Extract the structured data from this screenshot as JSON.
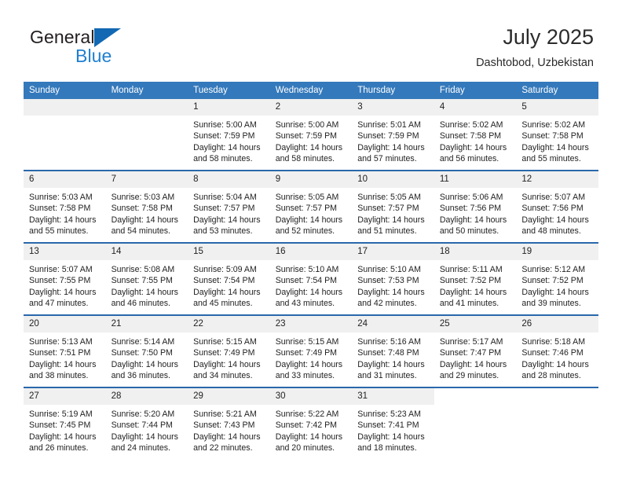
{
  "brand": {
    "name_part1": "General",
    "name_part2": "Blue",
    "logo_icon": "blue-triangle-logo"
  },
  "header": {
    "title": "July 2025",
    "subtitle": "Dashtobod, Uzbekistan"
  },
  "colors": {
    "header_blue": "#3479bb",
    "separator_blue": "#2a68ab",
    "daynum_band": "#f0f0f0",
    "brand_blue": "#1f7fd0",
    "text": "#222222"
  },
  "calendar": {
    "weekday_headers": [
      "Sunday",
      "Monday",
      "Tuesday",
      "Wednesday",
      "Thursday",
      "Friday",
      "Saturday"
    ],
    "weeks": [
      [
        {
          "day": "",
          "empty": true,
          "sunrise": "",
          "sunset": "",
          "daylight1": "",
          "daylight2": ""
        },
        {
          "day": "",
          "empty": true,
          "sunrise": "",
          "sunset": "",
          "daylight1": "",
          "daylight2": ""
        },
        {
          "day": "1",
          "sunrise": "Sunrise: 5:00 AM",
          "sunset": "Sunset: 7:59 PM",
          "daylight1": "Daylight: 14 hours",
          "daylight2": "and 58 minutes."
        },
        {
          "day": "2",
          "sunrise": "Sunrise: 5:00 AM",
          "sunset": "Sunset: 7:59 PM",
          "daylight1": "Daylight: 14 hours",
          "daylight2": "and 58 minutes."
        },
        {
          "day": "3",
          "sunrise": "Sunrise: 5:01 AM",
          "sunset": "Sunset: 7:59 PM",
          "daylight1": "Daylight: 14 hours",
          "daylight2": "and 57 minutes."
        },
        {
          "day": "4",
          "sunrise": "Sunrise: 5:02 AM",
          "sunset": "Sunset: 7:58 PM",
          "daylight1": "Daylight: 14 hours",
          "daylight2": "and 56 minutes."
        },
        {
          "day": "5",
          "sunrise": "Sunrise: 5:02 AM",
          "sunset": "Sunset: 7:58 PM",
          "daylight1": "Daylight: 14 hours",
          "daylight2": "and 55 minutes."
        }
      ],
      [
        {
          "day": "6",
          "sunrise": "Sunrise: 5:03 AM",
          "sunset": "Sunset: 7:58 PM",
          "daylight1": "Daylight: 14 hours",
          "daylight2": "and 55 minutes."
        },
        {
          "day": "7",
          "sunrise": "Sunrise: 5:03 AM",
          "sunset": "Sunset: 7:58 PM",
          "daylight1": "Daylight: 14 hours",
          "daylight2": "and 54 minutes."
        },
        {
          "day": "8",
          "sunrise": "Sunrise: 5:04 AM",
          "sunset": "Sunset: 7:57 PM",
          "daylight1": "Daylight: 14 hours",
          "daylight2": "and 53 minutes."
        },
        {
          "day": "9",
          "sunrise": "Sunrise: 5:05 AM",
          "sunset": "Sunset: 7:57 PM",
          "daylight1": "Daylight: 14 hours",
          "daylight2": "and 52 minutes."
        },
        {
          "day": "10",
          "sunrise": "Sunrise: 5:05 AM",
          "sunset": "Sunset: 7:57 PM",
          "daylight1": "Daylight: 14 hours",
          "daylight2": "and 51 minutes."
        },
        {
          "day": "11",
          "sunrise": "Sunrise: 5:06 AM",
          "sunset": "Sunset: 7:56 PM",
          "daylight1": "Daylight: 14 hours",
          "daylight2": "and 50 minutes."
        },
        {
          "day": "12",
          "sunrise": "Sunrise: 5:07 AM",
          "sunset": "Sunset: 7:56 PM",
          "daylight1": "Daylight: 14 hours",
          "daylight2": "and 48 minutes."
        }
      ],
      [
        {
          "day": "13",
          "sunrise": "Sunrise: 5:07 AM",
          "sunset": "Sunset: 7:55 PM",
          "daylight1": "Daylight: 14 hours",
          "daylight2": "and 47 minutes."
        },
        {
          "day": "14",
          "sunrise": "Sunrise: 5:08 AM",
          "sunset": "Sunset: 7:55 PM",
          "daylight1": "Daylight: 14 hours",
          "daylight2": "and 46 minutes."
        },
        {
          "day": "15",
          "sunrise": "Sunrise: 5:09 AM",
          "sunset": "Sunset: 7:54 PM",
          "daylight1": "Daylight: 14 hours",
          "daylight2": "and 45 minutes."
        },
        {
          "day": "16",
          "sunrise": "Sunrise: 5:10 AM",
          "sunset": "Sunset: 7:54 PM",
          "daylight1": "Daylight: 14 hours",
          "daylight2": "and 43 minutes."
        },
        {
          "day": "17",
          "sunrise": "Sunrise: 5:10 AM",
          "sunset": "Sunset: 7:53 PM",
          "daylight1": "Daylight: 14 hours",
          "daylight2": "and 42 minutes."
        },
        {
          "day": "18",
          "sunrise": "Sunrise: 5:11 AM",
          "sunset": "Sunset: 7:52 PM",
          "daylight1": "Daylight: 14 hours",
          "daylight2": "and 41 minutes."
        },
        {
          "day": "19",
          "sunrise": "Sunrise: 5:12 AM",
          "sunset": "Sunset: 7:52 PM",
          "daylight1": "Daylight: 14 hours",
          "daylight2": "and 39 minutes."
        }
      ],
      [
        {
          "day": "20",
          "sunrise": "Sunrise: 5:13 AM",
          "sunset": "Sunset: 7:51 PM",
          "daylight1": "Daylight: 14 hours",
          "daylight2": "and 38 minutes."
        },
        {
          "day": "21",
          "sunrise": "Sunrise: 5:14 AM",
          "sunset": "Sunset: 7:50 PM",
          "daylight1": "Daylight: 14 hours",
          "daylight2": "and 36 minutes."
        },
        {
          "day": "22",
          "sunrise": "Sunrise: 5:15 AM",
          "sunset": "Sunset: 7:49 PM",
          "daylight1": "Daylight: 14 hours",
          "daylight2": "and 34 minutes."
        },
        {
          "day": "23",
          "sunrise": "Sunrise: 5:15 AM",
          "sunset": "Sunset: 7:49 PM",
          "daylight1": "Daylight: 14 hours",
          "daylight2": "and 33 minutes."
        },
        {
          "day": "24",
          "sunrise": "Sunrise: 5:16 AM",
          "sunset": "Sunset: 7:48 PM",
          "daylight1": "Daylight: 14 hours",
          "daylight2": "and 31 minutes."
        },
        {
          "day": "25",
          "sunrise": "Sunrise: 5:17 AM",
          "sunset": "Sunset: 7:47 PM",
          "daylight1": "Daylight: 14 hours",
          "daylight2": "and 29 minutes."
        },
        {
          "day": "26",
          "sunrise": "Sunrise: 5:18 AM",
          "sunset": "Sunset: 7:46 PM",
          "daylight1": "Daylight: 14 hours",
          "daylight2": "and 28 minutes."
        }
      ],
      [
        {
          "day": "27",
          "sunrise": "Sunrise: 5:19 AM",
          "sunset": "Sunset: 7:45 PM",
          "daylight1": "Daylight: 14 hours",
          "daylight2": "and 26 minutes."
        },
        {
          "day": "28",
          "sunrise": "Sunrise: 5:20 AM",
          "sunset": "Sunset: 7:44 PM",
          "daylight1": "Daylight: 14 hours",
          "daylight2": "and 24 minutes."
        },
        {
          "day": "29",
          "sunrise": "Sunrise: 5:21 AM",
          "sunset": "Sunset: 7:43 PM",
          "daylight1": "Daylight: 14 hours",
          "daylight2": "and 22 minutes."
        },
        {
          "day": "30",
          "sunrise": "Sunrise: 5:22 AM",
          "sunset": "Sunset: 7:42 PM",
          "daylight1": "Daylight: 14 hours",
          "daylight2": "and 20 minutes."
        },
        {
          "day": "31",
          "sunrise": "Sunrise: 5:23 AM",
          "sunset": "Sunset: 7:41 PM",
          "daylight1": "Daylight: 14 hours",
          "daylight2": "and 18 minutes."
        },
        {
          "day": "",
          "empty": true,
          "sunrise": "",
          "sunset": "",
          "daylight1": "",
          "daylight2": ""
        },
        {
          "day": "",
          "empty": true,
          "sunrise": "",
          "sunset": "",
          "daylight1": "",
          "daylight2": ""
        }
      ]
    ]
  }
}
